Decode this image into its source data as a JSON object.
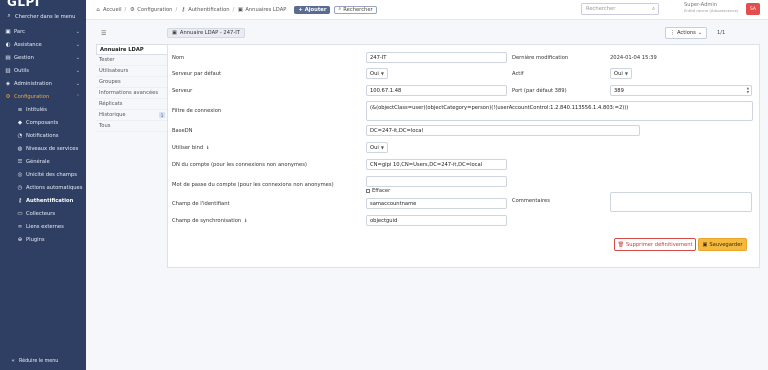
{
  "app": {
    "logo": "GLPI"
  },
  "sidebar": {
    "search_label": "Chercher dans le menu",
    "items": [
      {
        "label": "Parc",
        "icon": "box-icon"
      },
      {
        "label": "Assistance",
        "icon": "headset-icon"
      },
      {
        "label": "Gestion",
        "icon": "wallet-icon"
      },
      {
        "label": "Outils",
        "icon": "briefcase-icon"
      },
      {
        "label": "Administration",
        "icon": "shield-icon"
      },
      {
        "label": "Configuration",
        "icon": "gear-icon"
      }
    ],
    "sub_items": [
      {
        "label": "Intitulés",
        "icon": "list-icon"
      },
      {
        "label": "Composants",
        "icon": "components-icon"
      },
      {
        "label": "Notifications",
        "icon": "bell-icon"
      },
      {
        "label": "Niveaux de services",
        "icon": "gauge-icon"
      },
      {
        "label": "Générale",
        "icon": "sliders-icon"
      },
      {
        "label": "Unicité des champs",
        "icon": "fingerprint-icon"
      },
      {
        "label": "Actions automatiques",
        "icon": "clock-icon"
      },
      {
        "label": "Authentification",
        "icon": "key-icon"
      },
      {
        "label": "Collecteurs",
        "icon": "inbox-icon"
      },
      {
        "label": "Liens externes",
        "icon": "link-icon"
      },
      {
        "label": "Plugins",
        "icon": "plug-icon"
      }
    ],
    "collapse_label": "Réduire le menu"
  },
  "header": {
    "breadcrumbs": [
      "Accueil",
      "Configuration",
      "Authentification",
      "Annuaires LDAP"
    ],
    "add_label": "Ajouter",
    "search_label": "Rechercher",
    "search_placeholder": "Rechercher",
    "user_name": "Super-Admin",
    "user_entity": "Entité racine (Arborescence)",
    "avatar_initials": "SA"
  },
  "item": {
    "tag": "Annuaire LDAP - 247-IT",
    "actions_label": "Actions",
    "pager": "1/1"
  },
  "tabs": [
    {
      "label": "Annuaire LDAP"
    },
    {
      "label": "Tester"
    },
    {
      "label": "Utilisateurs"
    },
    {
      "label": "Groupes"
    },
    {
      "label": "Informations avancées"
    },
    {
      "label": "Réplicats"
    },
    {
      "label": "Historique",
      "badge": "1"
    },
    {
      "label": "Tous"
    }
  ],
  "form": {
    "name_label": "Nom",
    "name_value": "247-IT",
    "last_modified_label": "Dernière modification",
    "last_modified_value": "2024-01-04 15:39",
    "default_server_label": "Serveur par défaut",
    "default_server_value": "Oui",
    "active_label": "Actif",
    "active_value": "Oui",
    "server_label": "Serveur",
    "server_value": "100.67.1.48",
    "port_label": "Port (par défaut 389)",
    "port_value": "389",
    "filter_label": "Filtre de connexion",
    "filter_value": "(&(objectClass=user)(objectCategory=person)(!(userAccountControl:1.2.840.113556.1.4.803:=2)))",
    "basedn_label": "BaseDN",
    "basedn_value": "DC=247-it,DC=local",
    "bind_label": "Utiliser bind",
    "bind_value": "Oui",
    "rootdn_label": "DN du compte (pour les connexions non anonymes)",
    "rootdn_value": "CN=glpi 10,CN=Users,DC=247-it,DC=local",
    "password_label": "Mot de passe du compte (pour les connexions non anonymes)",
    "password_value": "",
    "clear_label": "Effacer",
    "identifier_label": "Champ de l'identifiant",
    "identifier_value": "samaccountname",
    "comments_label": "Commentaires",
    "sync_label": "Champ de synchronisation",
    "sync_value": "objectguid",
    "delete_label": "Supprimer définitivement",
    "save_label": "Sauvegarder"
  }
}
